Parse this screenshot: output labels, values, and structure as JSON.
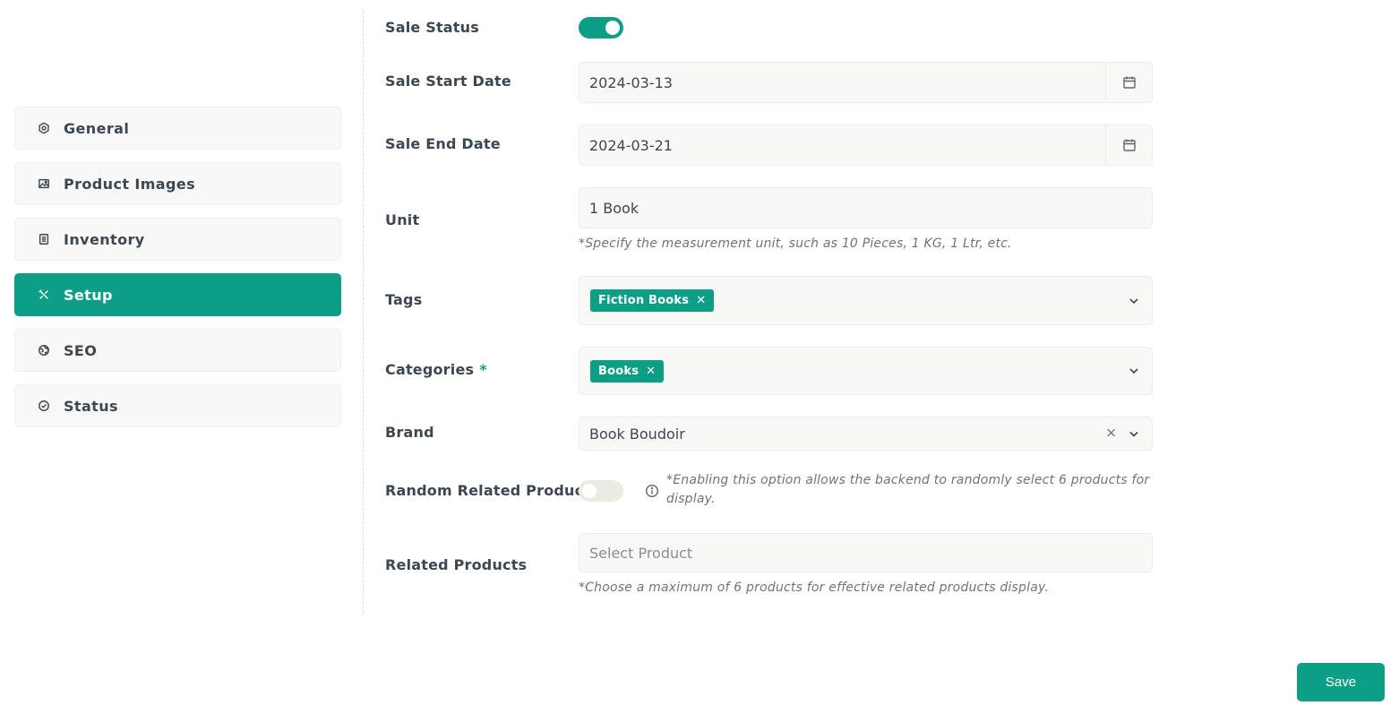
{
  "sidebar": {
    "items": [
      {
        "label": "General",
        "icon": "hexagon-icon",
        "active": false
      },
      {
        "label": "Product Images",
        "icon": "image-icon",
        "active": false
      },
      {
        "label": "Inventory",
        "icon": "list-icon",
        "active": false
      },
      {
        "label": "Setup",
        "icon": "tools-icon",
        "active": true
      },
      {
        "label": "SEO",
        "icon": "globe-icon",
        "active": false
      },
      {
        "label": "Status",
        "icon": "check-circle-icon",
        "active": false
      }
    ]
  },
  "form": {
    "sale_status": {
      "label": "Sale Status",
      "enabled": true
    },
    "sale_start_date": {
      "label": "Sale Start Date",
      "value": "2024-03-13"
    },
    "sale_end_date": {
      "label": "Sale End Date",
      "value": "2024-03-21"
    },
    "unit": {
      "label": "Unit",
      "value": "1 Book",
      "hint": "*Specify the measurement unit, such as 10 Pieces, 1 KG, 1 Ltr, etc."
    },
    "tags": {
      "label": "Tags",
      "selected": [
        "Fiction Books"
      ]
    },
    "categories": {
      "label": "Categories",
      "required_mark": "*",
      "selected": [
        "Books"
      ]
    },
    "brand": {
      "label": "Brand",
      "value": "Book Boudoir"
    },
    "random_related_product": {
      "label": "Random Related Product",
      "enabled": false,
      "info": "*Enabling this option allows the backend to randomly select 6 products for display."
    },
    "related_products": {
      "label": "Related Products",
      "placeholder": "Select Product",
      "hint": "*Choose a maximum of 6 products for effective related products display."
    }
  },
  "actions": {
    "save_label": "Save"
  },
  "colors": {
    "accent": "#0c9f86",
    "field_bg": "#f8f8f6",
    "text": "#3d4751"
  }
}
